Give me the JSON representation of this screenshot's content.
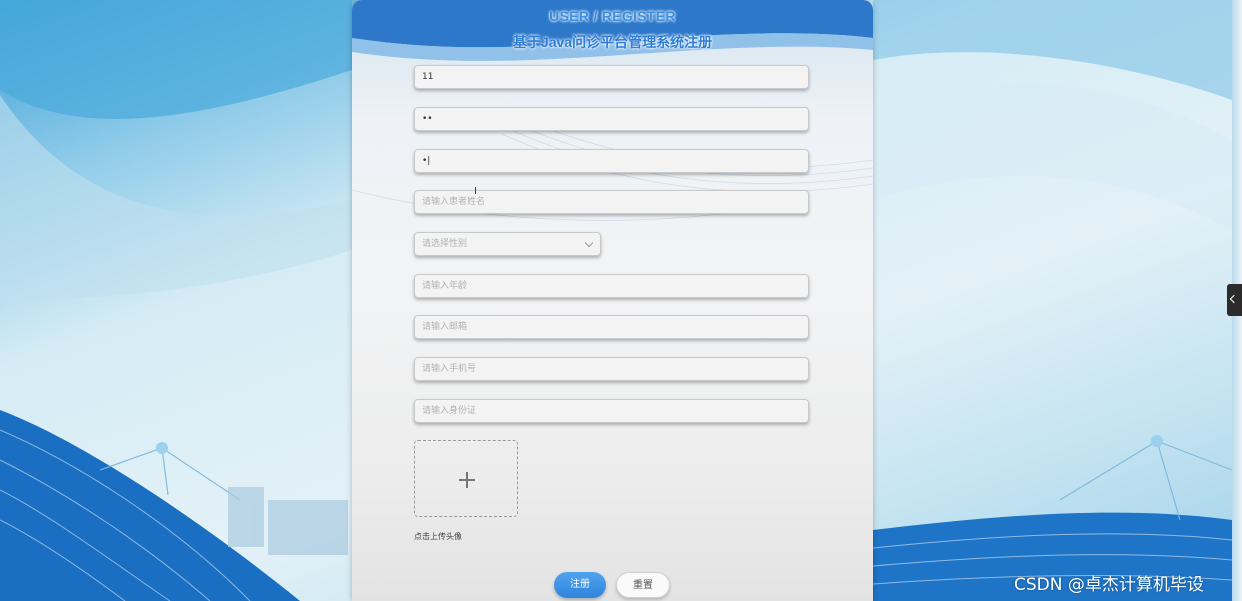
{
  "header": {
    "title_en": "USER / REGISTER",
    "title_cn": "基于Java问诊平台管理系统注册"
  },
  "form": {
    "fields": [
      {
        "value": "11",
        "placeholder": ""
      },
      {
        "value": "••",
        "placeholder": ""
      },
      {
        "value": "•|",
        "placeholder": ""
      },
      {
        "value": "",
        "placeholder": "请输入患者姓名"
      },
      {
        "value": "",
        "placeholder": "请选择性别"
      },
      {
        "value": "",
        "placeholder": "请输入年龄"
      },
      {
        "value": "",
        "placeholder": "请输入邮箱"
      },
      {
        "value": "",
        "placeholder": "请输入手机号"
      },
      {
        "value": "",
        "placeholder": "请输入身份证"
      }
    ],
    "upload_hint": "点击上传头像",
    "register_label": "注册",
    "reset_label": "重置"
  },
  "watermark": "CSDN @卓杰计算机毕设",
  "colors": {
    "accent": "#3b8ee0",
    "button_primary": "#2f84dc"
  }
}
